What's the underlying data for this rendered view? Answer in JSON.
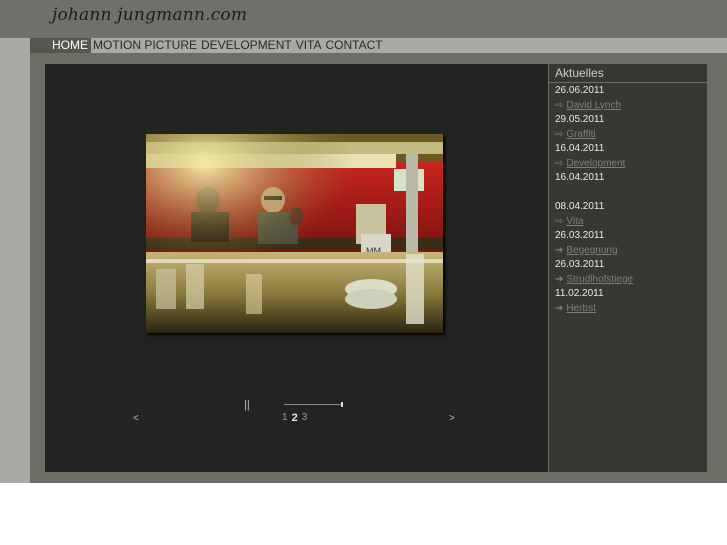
{
  "logo": "johann jungmann.com",
  "nav": [
    "HOME",
    "MOTION PICTURE",
    "DEVELOPMENT",
    "VITA",
    "CONTACT"
  ],
  "slideshow": {
    "pause": "||",
    "prev": "<",
    "next": ">",
    "pages": [
      "1",
      "2",
      "3"
    ],
    "current_page": "2",
    "progress_fraction": 1.0
  },
  "news": {
    "title": "Aktuelles",
    "items": [
      {
        "date": "26.06.2011",
        "arrow": "⇨",
        "link": "David Lynch"
      },
      {
        "date": "29.05.2011",
        "arrow": "⇨",
        "link": "Graffiti"
      },
      {
        "date": "16.04.2011",
        "arrow": "⇨",
        "link": "Development"
      },
      {
        "date": "16.04.2011",
        "arrow": "",
        "link": ""
      },
      {
        "date": "08.04.2011",
        "arrow": "⇨",
        "link": "Vita"
      },
      {
        "date": "26.03.2011",
        "arrow": "➔",
        "link": "Begegnung"
      },
      {
        "date": "26.03.2011",
        "arrow": "➔",
        "link": "Strudlhofstiege"
      },
      {
        "date": "11.02.2011",
        "arrow": "➔",
        "link": "Herbst"
      }
    ]
  },
  "colors": {
    "header": "#6e7169",
    "stage": "#222421",
    "news_panel": "#363834",
    "accent_red": "#b01f1f"
  }
}
